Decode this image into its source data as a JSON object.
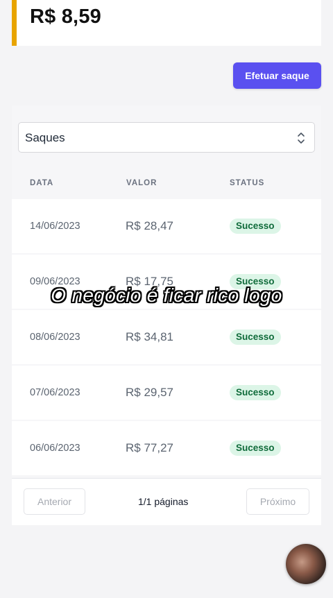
{
  "balance": {
    "amount": "R$ 8,59"
  },
  "actions": {
    "withdraw_label": "Efetuar saque"
  },
  "filter": {
    "selected": "Saques"
  },
  "table": {
    "headers": {
      "date": "DATA",
      "value": "VALOR",
      "status": "STATUS"
    },
    "rows": [
      {
        "date": "14/06/2023",
        "value": "R$ 28,47",
        "status": "Sucesso"
      },
      {
        "date": "09/06/2023",
        "value": "R$ 17,75",
        "status": "Sucesso"
      },
      {
        "date": "08/06/2023",
        "value": "R$ 34,81",
        "status": "Sucesso"
      },
      {
        "date": "07/06/2023",
        "value": "R$ 29,57",
        "status": "Sucesso"
      },
      {
        "date": "06/06/2023",
        "value": "R$ 77,27",
        "status": "Sucesso"
      }
    ]
  },
  "pagination": {
    "prev_label": "Anterior",
    "info": "1/1 páginas",
    "next_label": "Próximo"
  },
  "overlay": {
    "caption": "O negócio é ficar rico logo"
  },
  "colors": {
    "accent": "#5a50f0",
    "balance_border": "#e8a400",
    "success_bg": "#dcf5e7",
    "success_text": "#0f6b3a"
  }
}
